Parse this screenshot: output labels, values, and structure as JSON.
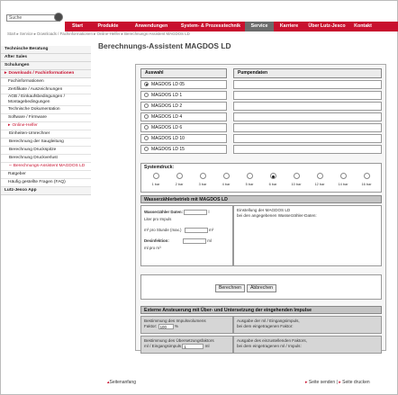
{
  "search": {
    "value": "Suche"
  },
  "nav": {
    "items": [
      {
        "label": "Start",
        "active": false
      },
      {
        "label": "Produkte",
        "active": false
      },
      {
        "label": "Anwendungen",
        "active": false
      },
      {
        "label": "System- & Prozesstechnik",
        "active": false
      },
      {
        "label": "Service",
        "active": true
      },
      {
        "label": "Karriere",
        "active": false
      },
      {
        "label": "Über Lutz-Jesco",
        "active": false
      },
      {
        "label": "Kontakt",
        "active": false
      }
    ]
  },
  "breadcrumb": "Start  ▸ Service  ▸ Downloads / Fachinformationen  ▸ Online-Helfer  ▸ Berechnungs-Assistent MAGDOS LD",
  "sidebar": {
    "items": [
      {
        "label": "Technische Beratung",
        "level": 0
      },
      {
        "label": "After Sales",
        "level": 0
      },
      {
        "label": "Schulungen",
        "level": 0
      },
      {
        "label": "Downloads / Fachinformationen",
        "level": 0,
        "marker": "▸",
        "red": true
      },
      {
        "label": "Fachinformationen",
        "level": 1
      },
      {
        "label": "Zertifikate / Auszeichnungen",
        "level": 1
      },
      {
        "label": "AGB / Einkaufsbedingungen / Montagebedingungen",
        "level": 1
      },
      {
        "label": "Technische Dokumentation",
        "level": 1
      },
      {
        "label": "Software / Firmware",
        "level": 1
      },
      {
        "label": "Online-Helfer",
        "level": 1,
        "marker": "▸",
        "red": true
      },
      {
        "label": "Einheiten-Umrechner",
        "level": 2
      },
      {
        "label": "Berechnung der Saugleitung",
        "level": 2
      },
      {
        "label": "Berechnung Druckspitze",
        "level": 2
      },
      {
        "label": "Berechnung Druckverlust",
        "level": 2
      },
      {
        "label": "Berechnungs-Assistent MAGDOS LD",
        "level": 2,
        "marker": "–",
        "red": true
      },
      {
        "label": "Ratgeber",
        "level": 1
      },
      {
        "label": "Häufig gestellte Fragen (FAQ)",
        "level": 1
      },
      {
        "label": "Lutz-Jesco App",
        "level": 0
      }
    ]
  },
  "page": {
    "title": "Berechnungs-Assistent MAGDOS LD"
  },
  "tool": {
    "col_auswahl": "Auswahl",
    "col_pumpendaten": "Pumpendaten",
    "pumps": [
      "MAGDOS LD 05",
      "MAGDOS LD 1",
      "MAGDOS LD 2",
      "MAGDOS LD 4",
      "MAGDOS LD 6",
      "MAGDOS LD 10",
      "MAGDOS LD 15"
    ],
    "selected_pump": "MAGDOS LD 05",
    "pressure_label": "Systemdruck:",
    "pressures": [
      "1 bar",
      "2 bar",
      "3 bar",
      "4 bar",
      "5 bar",
      "6 bar",
      "10 bar",
      "12 bar",
      "14 bar",
      "16 bar"
    ],
    "selected_pressure": "6 bar",
    "wz_header": "Wasserzählerbetrieb mit MAGDOS LD",
    "wz_data_label": "Wasserzähler Daten:",
    "wz_l_per_impulse": "Liter pro Impuls",
    "wz_m3_label": "m³ pro Stunde (max.)",
    "wz_m3_unit": "m³",
    "wz_dose_label": "Desinfektion:",
    "wz_dose_unit": "ml",
    "wz_ml_per_m3": "ml pro m³",
    "wz_right_1": "Einstellung der MAGDOS LD",
    "wz_right_2": "bei den angegebenen Wasserzähler-Daten:",
    "btn_calc": "Berechnen",
    "btn_cancel": "Abbrechen",
    "ext_header": "Externe Ansteuerung mit Über- und Untersetzung der eingehenden Impulse",
    "ext_left_1": "Bestimmung des Impulsvolumens",
    "ext_faktor_label": "Faktor:",
    "ext_faktor_value": "100",
    "ext_faktor_unit": "%",
    "ext_right_1": "Ausgabe der ml / Eingangsimpuls,",
    "ext_right_2": "bei dem eingetragenen Faktor:",
    "ext2_left_1": "Bestimmung des Übersetzungsfaktors",
    "ext2_left_2": "ml / Eingangsimpuls",
    "ext2_value": "1",
    "ext2_unit": "ml",
    "ext2_right_1": "Ausgabe des einzustellenden Faktors,",
    "ext2_right_2": "bei dem eingetragenen ml / Impuls:"
  },
  "footer": {
    "top_link": "Seitenanfang",
    "send": "Seite senden",
    "print": "Seite drucken",
    "sep": "|"
  }
}
